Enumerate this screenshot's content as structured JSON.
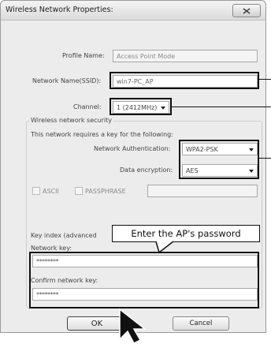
{
  "window": {
    "title": "Wireless Network Properties:"
  },
  "profile": {
    "label": "Profile Name:",
    "value": "Access Point Mode"
  },
  "ssid": {
    "label": "Network Name(SSID):",
    "value": "win7-PC_AP"
  },
  "channel": {
    "label": "Channel:",
    "value": "1  (2412MHz)"
  },
  "security": {
    "group_label": "Wireless network security",
    "requires_text": "This network requires a key for the following:",
    "auth_label": "Network Authentication:",
    "auth_value": "WPA2-PSK",
    "enc_label": "Data encryption:",
    "enc_value": "AES",
    "ascii_label": "ASCII",
    "passphrase_label": "PASSPHRASE",
    "key_index_label": "Key index (advanced",
    "key_label": "Network key:",
    "key_value": "********",
    "confirm_label": "Confirm network key:",
    "confirm_value": "********"
  },
  "callout": "Enter the AP's password",
  "buttons": {
    "ok": "OK",
    "cancel": "Cancel"
  },
  "icons": [
    "close-icon",
    "chevron-down-icon",
    "mouse-pointer-icon"
  ]
}
